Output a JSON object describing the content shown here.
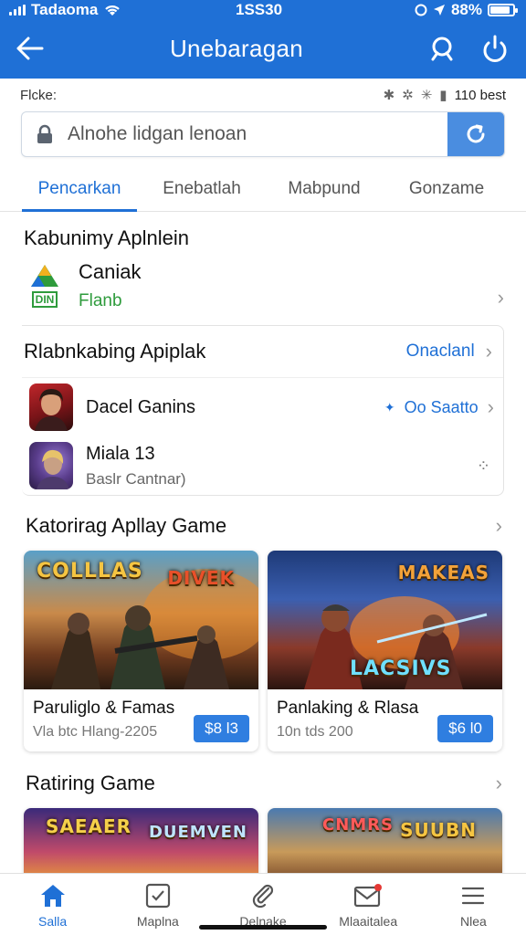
{
  "status_bar": {
    "carrier": "Tadaoma",
    "time": "1SS30",
    "battery": "88%",
    "battery_level": 0.88
  },
  "header": {
    "title": "Unebaragan",
    "back_icon": "back-arrow-icon",
    "search_icon": "search-icon",
    "share_icon": "share-icon"
  },
  "filter_row": {
    "label": "Flcke:",
    "right_text": "110 best"
  },
  "search": {
    "placeholder": "Alnohe lidgan lenoan",
    "icon": "lock-icon",
    "action_icon": "refresh-icon"
  },
  "tabs": [
    {
      "label": "Pencarkan",
      "active": true
    },
    {
      "label": "Enebatlah",
      "active": false
    },
    {
      "label": "Mabpund",
      "active": false
    },
    {
      "label": "Gonzame",
      "active": false
    }
  ],
  "featured": {
    "title": "Kabunimy Aplnlein",
    "app_name": "Caniak",
    "app_sub": "Flanb",
    "badge": "DIN"
  },
  "ranking": {
    "title": "Rlabnkabing Apiplak",
    "more": "Onaclanl",
    "items": [
      {
        "name": "Dacel Ganins",
        "action": "Oo Saatto"
      },
      {
        "name": "Miala 13",
        "sub": "Baslr Cantnar)"
      }
    ]
  },
  "category": {
    "title": "Katorirag Apllay Game",
    "games": [
      {
        "art_title": "COLLLAS",
        "art_sub": "DIVEK",
        "name": "Paruliglo & Famas",
        "meta": "Vla btc Hlang-2205",
        "price": "$8 l3"
      },
      {
        "art_title": "LACSIVS",
        "art_sub": "MAKEAS",
        "name": "Panlaking & Rlasa",
        "meta": "10n tds 200",
        "price": "$6 l0"
      }
    ]
  },
  "rating": {
    "title": "Ratiring Game",
    "games": [
      {
        "art_title": "SAEAER",
        "art_sub": "DUEMVEN"
      },
      {
        "art_title": "CNMRS",
        "art_sub": "SUUBN"
      }
    ]
  },
  "bottom_nav": [
    {
      "label": "Salla",
      "icon": "home-icon",
      "active": true
    },
    {
      "label": "Maplna",
      "icon": "check-icon",
      "active": false
    },
    {
      "label": "Delnake",
      "icon": "clip-icon",
      "active": false
    },
    {
      "label": "Mlaaitalea",
      "icon": "mail-icon",
      "active": false
    },
    {
      "label": "Nlea",
      "icon": "menu-icon",
      "active": false
    }
  ],
  "colors": {
    "primary": "#1f70d6",
    "price_button": "#2f7ee0",
    "green": "#2e9b3c"
  }
}
